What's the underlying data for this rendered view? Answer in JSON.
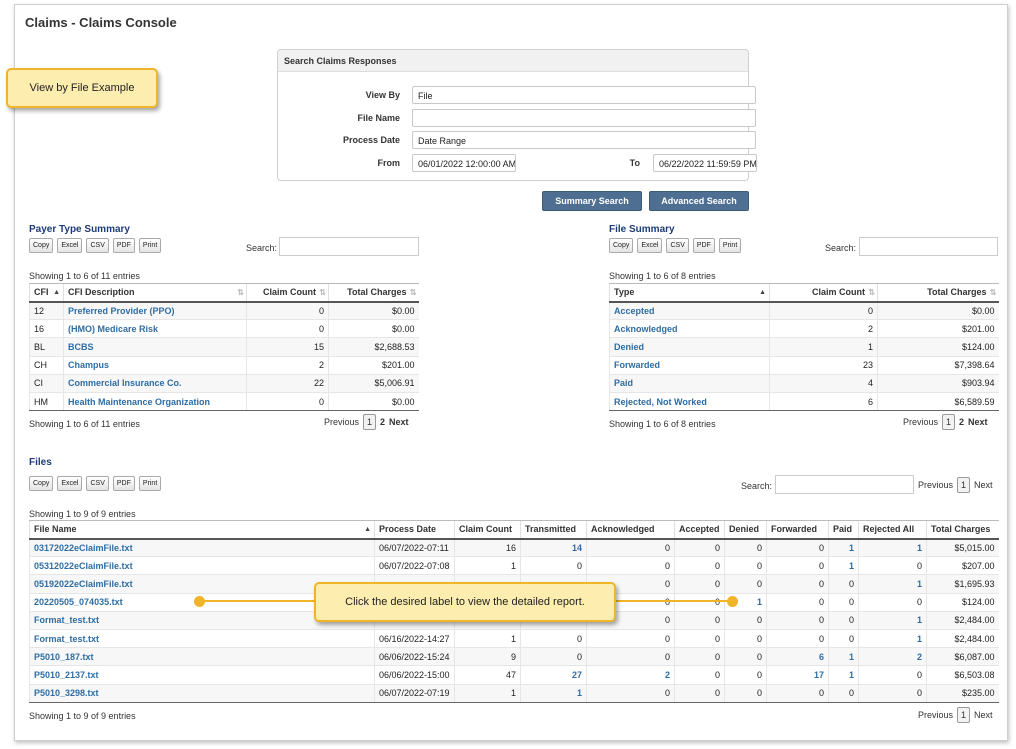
{
  "page_title": "Claims - Claims Console",
  "callouts": {
    "view_by_file": "View by File Example",
    "click_label": "Click the desired label to view the detailed report."
  },
  "search": {
    "header": "Search Claims Responses",
    "view_by_label": "View By",
    "view_by_value": "File",
    "file_name_label": "File Name",
    "file_name_value": "",
    "process_date_label": "Process Date",
    "process_date_value": "Date Range",
    "from_label": "From",
    "from_value": "06/01/2022 12:00:00 AM",
    "to_label": "To",
    "to_value": "06/22/2022 11:59:59 PM",
    "summary_button": "Summary Search",
    "advanced_button": "Advanced Search"
  },
  "toolbar": {
    "copy": "Copy",
    "excel": "Excel",
    "csv": "CSV",
    "pdf": "PDF",
    "print": "Print"
  },
  "search_label": "Search:",
  "pager": {
    "previous": "Previous",
    "next": "Next",
    "page1": "1",
    "page2": "2"
  },
  "payer_summary": {
    "title": "Payer Type Summary",
    "info_top": "Showing 1 to 6 of 11 entries",
    "info_bottom": "Showing 1 to 6 of 11 entries",
    "columns": [
      "CFI",
      "CFI Description",
      "Claim Count",
      "Total Charges"
    ],
    "rows": [
      [
        "12",
        "Preferred Provider (PPO)",
        "0",
        "$0.00"
      ],
      [
        "16",
        "(HMO) Medicare Risk",
        "0",
        "$0.00"
      ],
      [
        "BL",
        "BCBS",
        "15",
        "$2,688.53"
      ],
      [
        "CH",
        "Champus",
        "2",
        "$201.00"
      ],
      [
        "CI",
        "Commercial Insurance Co.",
        "22",
        "$5,006.91"
      ],
      [
        "HM",
        "Health Maintenance Organization",
        "0",
        "$0.00"
      ]
    ]
  },
  "file_summary": {
    "title": "File Summary",
    "info_top": "Showing 1 to 6 of 8 entries",
    "info_bottom": "Showing 1 to 6 of 8 entries",
    "columns": [
      "Type",
      "Claim Count",
      "Total Charges"
    ],
    "rows": [
      [
        "Accepted",
        "0",
        "$0.00"
      ],
      [
        "Acknowledged",
        "2",
        "$201.00"
      ],
      [
        "Denied",
        "1",
        "$124.00"
      ],
      [
        "Forwarded",
        "23",
        "$7,398.64"
      ],
      [
        "Paid",
        "4",
        "$903.94"
      ],
      [
        "Rejected, Not Worked",
        "6",
        "$6,589.59"
      ]
    ]
  },
  "files": {
    "title": "Files",
    "info_top": "Showing 1 to 9 of 9 entries",
    "info_bottom": "Showing 1 to 9 of 9 entries",
    "columns": [
      "File Name",
      "Process Date",
      "Claim Count",
      "Transmitted",
      "Acknowledged",
      "Accepted",
      "Denied",
      "Forwarded",
      "Paid",
      "Rejected All",
      "Total Charges"
    ],
    "rows": [
      [
        "03172022eClaimFile.txt",
        "06/07/2022-07:11",
        "16",
        "14",
        "0",
        "0",
        "0",
        "0",
        "1",
        "1",
        "$5,015.00"
      ],
      [
        "05312022eClaimFile.txt",
        "06/07/2022-07:08",
        "1",
        "0",
        "0",
        "0",
        "0",
        "0",
        "1",
        "0",
        "$207.00"
      ],
      [
        "05192022eClaimFile.txt",
        "",
        "",
        "",
        "0",
        "0",
        "0",
        "0",
        "0",
        "1",
        "$1,695.93"
      ],
      [
        "20220505_074035.txt",
        "",
        "",
        "",
        "0",
        "0",
        "1",
        "0",
        "0",
        "0",
        "$124.00"
      ],
      [
        "Format_test.txt",
        "",
        "",
        "",
        "0",
        "0",
        "0",
        "0",
        "0",
        "1",
        "$2,484.00"
      ],
      [
        "Format_test.txt",
        "06/16/2022-14:27",
        "1",
        "0",
        "0",
        "0",
        "0",
        "0",
        "0",
        "1",
        "$2,484.00"
      ],
      [
        "P5010_187.txt",
        "06/06/2022-15:24",
        "9",
        "0",
        "0",
        "0",
        "0",
        "6",
        "1",
        "2",
        "$6,087.00"
      ],
      [
        "P5010_2137.txt",
        "06/06/2022-15:00",
        "47",
        "27",
        "2",
        "0",
        "0",
        "17",
        "1",
        "0",
        "$6,503.08"
      ],
      [
        "P5010_3298.txt",
        "06/07/2022-07:19",
        "1",
        "1",
        "0",
        "0",
        "0",
        "0",
        "0",
        "0",
        "$235.00"
      ]
    ]
  },
  "colors": {
    "link": "#2e6da4",
    "button": "#4f6f92",
    "callout_bg": "#fdeeb0",
    "callout_border": "#f0b428",
    "section_title": "#1c3b78"
  }
}
